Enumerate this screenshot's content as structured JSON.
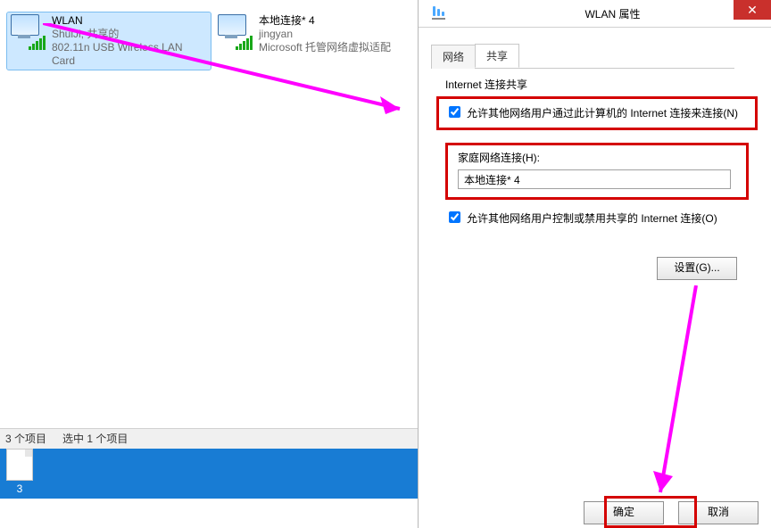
{
  "explorer": {
    "items": [
      {
        "title": "WLAN",
        "line2": "ShuiJi, 共享的",
        "line3": "802.11n USB Wireless LAN Card"
      },
      {
        "title": "本地连接* 4",
        "line2": "jingyan",
        "line3": "Microsoft 托管网络虚拟适配"
      }
    ],
    "status": {
      "count": "3 个项目",
      "selected": "选中 1 个项目"
    },
    "taskbar_badge": "3"
  },
  "dialog": {
    "title": "WLAN 属性",
    "tabs": {
      "network": "网络",
      "sharing": "共享"
    },
    "group": "Internet 连接共享",
    "chk_allow_other": "允许其他网络用户通过此计算机的 Internet 连接来连接(N)",
    "home_net_label": "家庭网络连接(H):",
    "home_net_value": "本地连接* 4",
    "chk_allow_control": "允许其他网络用户控制或禁用共享的 Internet 连接(O)",
    "settings_btn": "设置(G)...",
    "ok": "确定",
    "cancel": "取消"
  }
}
